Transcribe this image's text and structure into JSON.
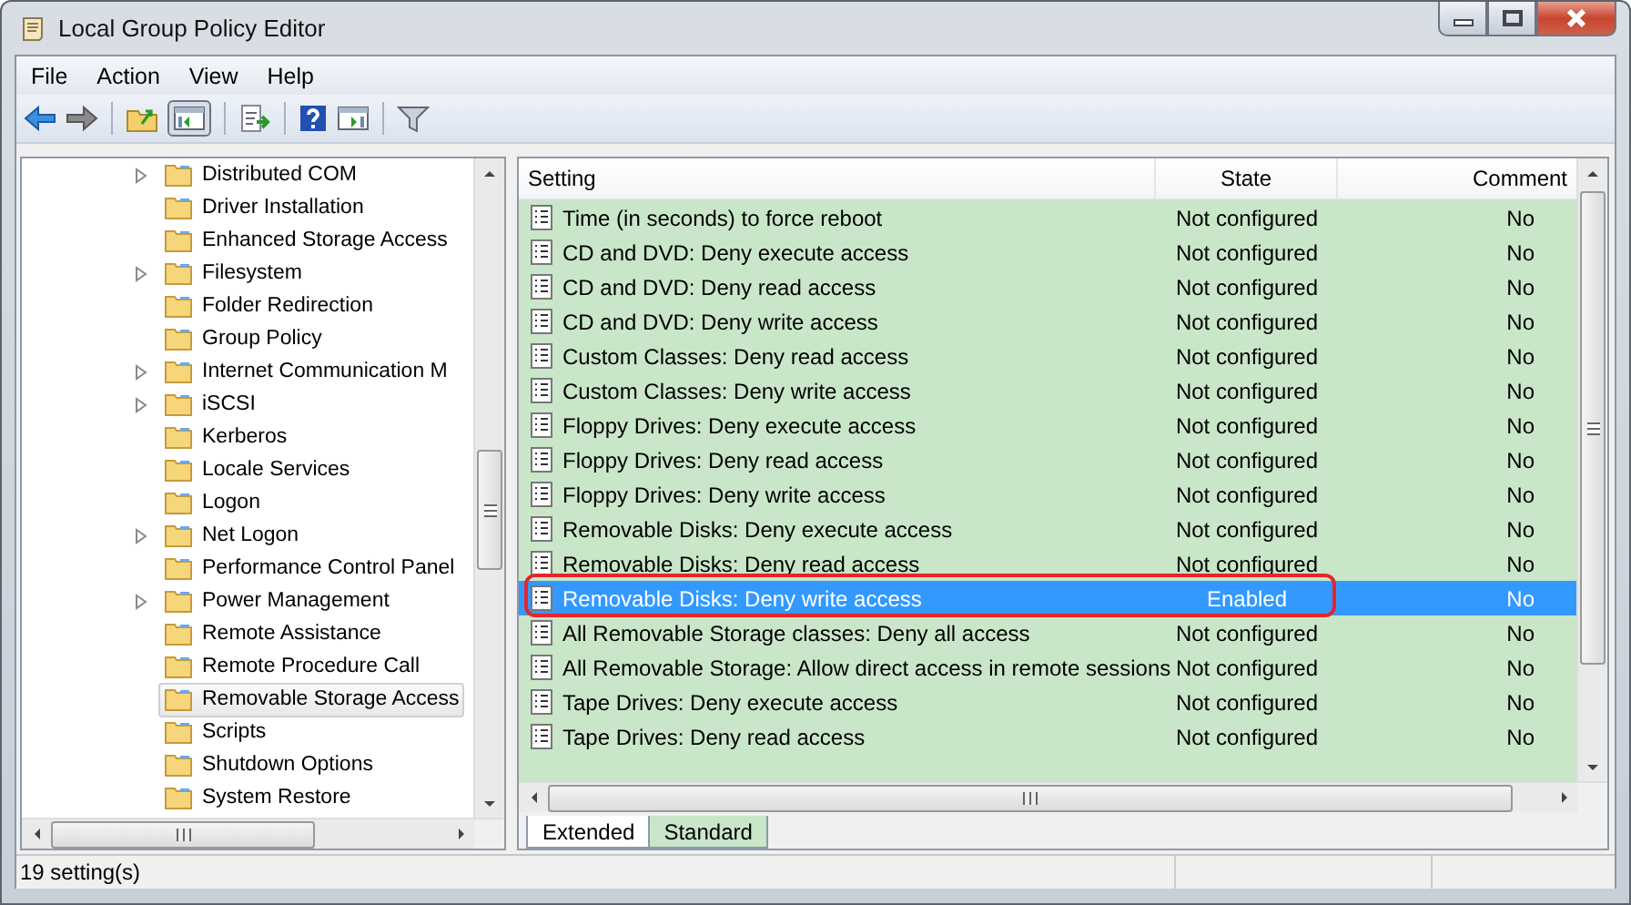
{
  "window": {
    "title": "Local Group Policy Editor"
  },
  "menu": [
    "File",
    "Action",
    "View",
    "Help"
  ],
  "tree": [
    {
      "label": "Distributed COM",
      "expandable": true,
      "selected": false
    },
    {
      "label": "Driver Installation",
      "expandable": false,
      "selected": false
    },
    {
      "label": "Enhanced Storage Access",
      "expandable": false,
      "selected": false
    },
    {
      "label": "Filesystem",
      "expandable": true,
      "selected": false
    },
    {
      "label": "Folder Redirection",
      "expandable": false,
      "selected": false
    },
    {
      "label": "Group Policy",
      "expandable": false,
      "selected": false
    },
    {
      "label": "Internet Communication M",
      "expandable": true,
      "selected": false
    },
    {
      "label": "iSCSI",
      "expandable": true,
      "selected": false
    },
    {
      "label": "Kerberos",
      "expandable": false,
      "selected": false
    },
    {
      "label": "Locale Services",
      "expandable": false,
      "selected": false
    },
    {
      "label": "Logon",
      "expandable": false,
      "selected": false
    },
    {
      "label": "Net Logon",
      "expandable": true,
      "selected": false
    },
    {
      "label": "Performance Control Panel",
      "expandable": false,
      "selected": false
    },
    {
      "label": "Power Management",
      "expandable": true,
      "selected": false
    },
    {
      "label": "Remote Assistance",
      "expandable": false,
      "selected": false
    },
    {
      "label": "Remote Procedure Call",
      "expandable": false,
      "selected": false
    },
    {
      "label": "Removable Storage Access",
      "expandable": false,
      "selected": true
    },
    {
      "label": "Scripts",
      "expandable": false,
      "selected": false
    },
    {
      "label": "Shutdown Options",
      "expandable": false,
      "selected": false
    },
    {
      "label": "System Restore",
      "expandable": false,
      "selected": false
    }
  ],
  "table": {
    "columns": [
      "Setting",
      "State",
      "Comment"
    ],
    "rows": [
      {
        "setting": "Time (in seconds) to force reboot",
        "state": "Not configured",
        "comment": "No",
        "selected": false,
        "annotated": false
      },
      {
        "setting": "CD and DVD: Deny execute access",
        "state": "Not configured",
        "comment": "No",
        "selected": false,
        "annotated": false
      },
      {
        "setting": "CD and DVD: Deny read access",
        "state": "Not configured",
        "comment": "No",
        "selected": false,
        "annotated": false
      },
      {
        "setting": "CD and DVD: Deny write access",
        "state": "Not configured",
        "comment": "No",
        "selected": false,
        "annotated": false
      },
      {
        "setting": "Custom Classes: Deny read access",
        "state": "Not configured",
        "comment": "No",
        "selected": false,
        "annotated": false
      },
      {
        "setting": "Custom Classes: Deny write access",
        "state": "Not configured",
        "comment": "No",
        "selected": false,
        "annotated": false
      },
      {
        "setting": "Floppy Drives: Deny execute access",
        "state": "Not configured",
        "comment": "No",
        "selected": false,
        "annotated": false
      },
      {
        "setting": "Floppy Drives: Deny read access",
        "state": "Not configured",
        "comment": "No",
        "selected": false,
        "annotated": false
      },
      {
        "setting": "Floppy Drives: Deny write access",
        "state": "Not configured",
        "comment": "No",
        "selected": false,
        "annotated": false
      },
      {
        "setting": "Removable Disks: Deny execute access",
        "state": "Not configured",
        "comment": "No",
        "selected": false,
        "annotated": false
      },
      {
        "setting": "Removable Disks: Deny read access",
        "state": "Not configured",
        "comment": "No",
        "selected": false,
        "annotated": false
      },
      {
        "setting": "Removable Disks: Deny write access",
        "state": "Enabled",
        "comment": "No",
        "selected": true,
        "annotated": true
      },
      {
        "setting": "All Removable Storage classes: Deny all access",
        "state": "Not configured",
        "comment": "No",
        "selected": false,
        "annotated": false
      },
      {
        "setting": "All Removable Storage: Allow direct access in remote sessions",
        "state": "Not configured",
        "comment": "No",
        "selected": false,
        "annotated": false
      },
      {
        "setting": "Tape Drives: Deny execute access",
        "state": "Not configured",
        "comment": "No",
        "selected": false,
        "annotated": false
      },
      {
        "setting": "Tape Drives: Deny read access",
        "state": "Not configured",
        "comment": "No",
        "selected": false,
        "annotated": false
      }
    ]
  },
  "view_tabs": [
    {
      "label": "Extended",
      "selected": false
    },
    {
      "label": "Standard",
      "selected": true
    }
  ],
  "status_bar": "19 setting(s)"
}
